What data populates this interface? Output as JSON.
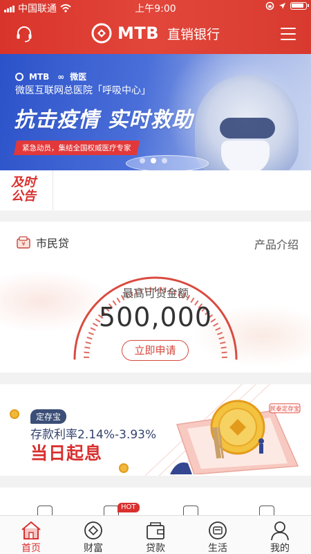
{
  "status_bar": {
    "carrier": "中国联通",
    "time": "上午9:00"
  },
  "header": {
    "brand": "MTB",
    "brand_sub": "直销银行",
    "accent": "#d9342b"
  },
  "banner": {
    "logo_left": "MTB",
    "logo_right": "微医",
    "hospital": "微医互联网总医院「呼吸中心」",
    "title": "抗击疫情 实时救助",
    "tag": "紧急动员，集结全国权威医疗专家",
    "page_dots": 3,
    "active_dot": 1
  },
  "notice": {
    "badge_line1": "及时",
    "badge_line2": "公告"
  },
  "loan": {
    "name": "市民贷",
    "intro_link": "产品介绍",
    "caption": "最高可贷金额",
    "amount": "500,000",
    "apply_button": "立即申请"
  },
  "deposit": {
    "tag": "定存宝",
    "rate": "存款利率2.14%-3.93%",
    "title": "当日起息",
    "art_label": "民泰定存宝"
  },
  "shortcuts": {
    "hot_badge": "HOT"
  },
  "tabs": [
    {
      "label": "首页",
      "icon": "home-icon",
      "active": true
    },
    {
      "label": "财富",
      "icon": "wealth-icon",
      "active": false
    },
    {
      "label": "贷款",
      "icon": "loan-icon",
      "active": false
    },
    {
      "label": "生活",
      "icon": "life-icon",
      "active": false
    },
    {
      "label": "我的",
      "icon": "profile-icon",
      "active": false
    }
  ]
}
